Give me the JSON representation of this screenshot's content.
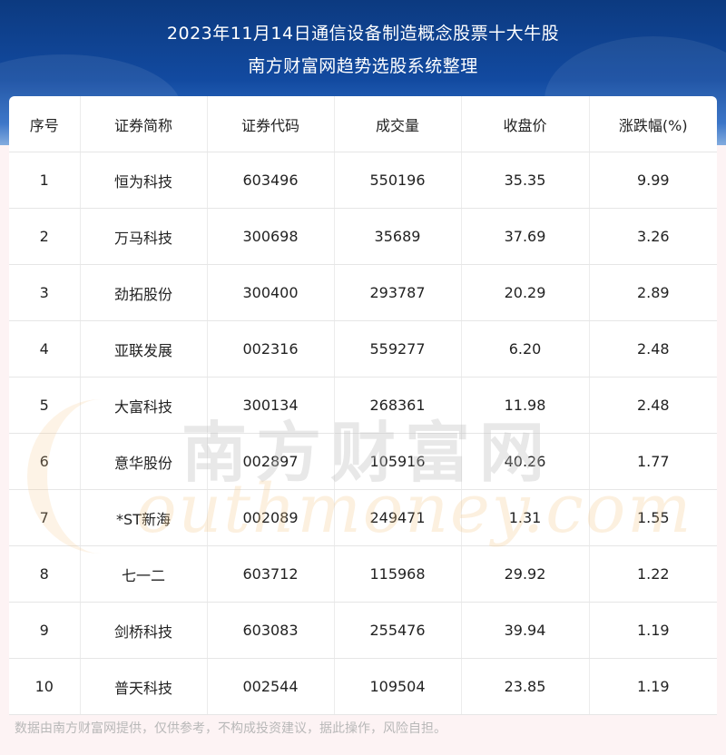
{
  "header": {
    "title_line1": "2023年11月14日通信设备制造概念股票十大牛股",
    "title_line2": "南方财富网趋势选股系统整理"
  },
  "table": {
    "columns": [
      "序号",
      "证券简称",
      "证券代码",
      "成交量",
      "收盘价",
      "涨跌幅(%)"
    ],
    "rows": [
      [
        "1",
        "恒为科技",
        "603496",
        "550196",
        "35.35",
        "9.99"
      ],
      [
        "2",
        "万马科技",
        "300698",
        "35689",
        "37.69",
        "3.26"
      ],
      [
        "3",
        "劲拓股份",
        "300400",
        "293787",
        "20.29",
        "2.89"
      ],
      [
        "4",
        "亚联发展",
        "002316",
        "559277",
        "6.20",
        "2.48"
      ],
      [
        "5",
        "大富科技",
        "300134",
        "268361",
        "11.98",
        "2.48"
      ],
      [
        "6",
        "意华股份",
        "002897",
        "105916",
        "40.26",
        "1.77"
      ],
      [
        "7",
        "*ST新海",
        "002089",
        "249471",
        "1.31",
        "1.55"
      ],
      [
        "8",
        "七一二",
        "603712",
        "115968",
        "29.92",
        "1.22"
      ],
      [
        "9",
        "剑桥科技",
        "603083",
        "255476",
        "39.94",
        "1.19"
      ],
      [
        "10",
        "普天科技",
        "002544",
        "109504",
        "23.85",
        "1.19"
      ]
    ]
  },
  "watermark": {
    "cn": "南方财富网",
    "en": "outhmoney.com"
  },
  "footer": {
    "disclaimer": "数据由南方财富网提供，仅供参考，不构成投资建议，据此操作，风险自担。"
  },
  "colors": {
    "header_blue": "#124aa0",
    "page_bg": "#fdf3f4"
  }
}
